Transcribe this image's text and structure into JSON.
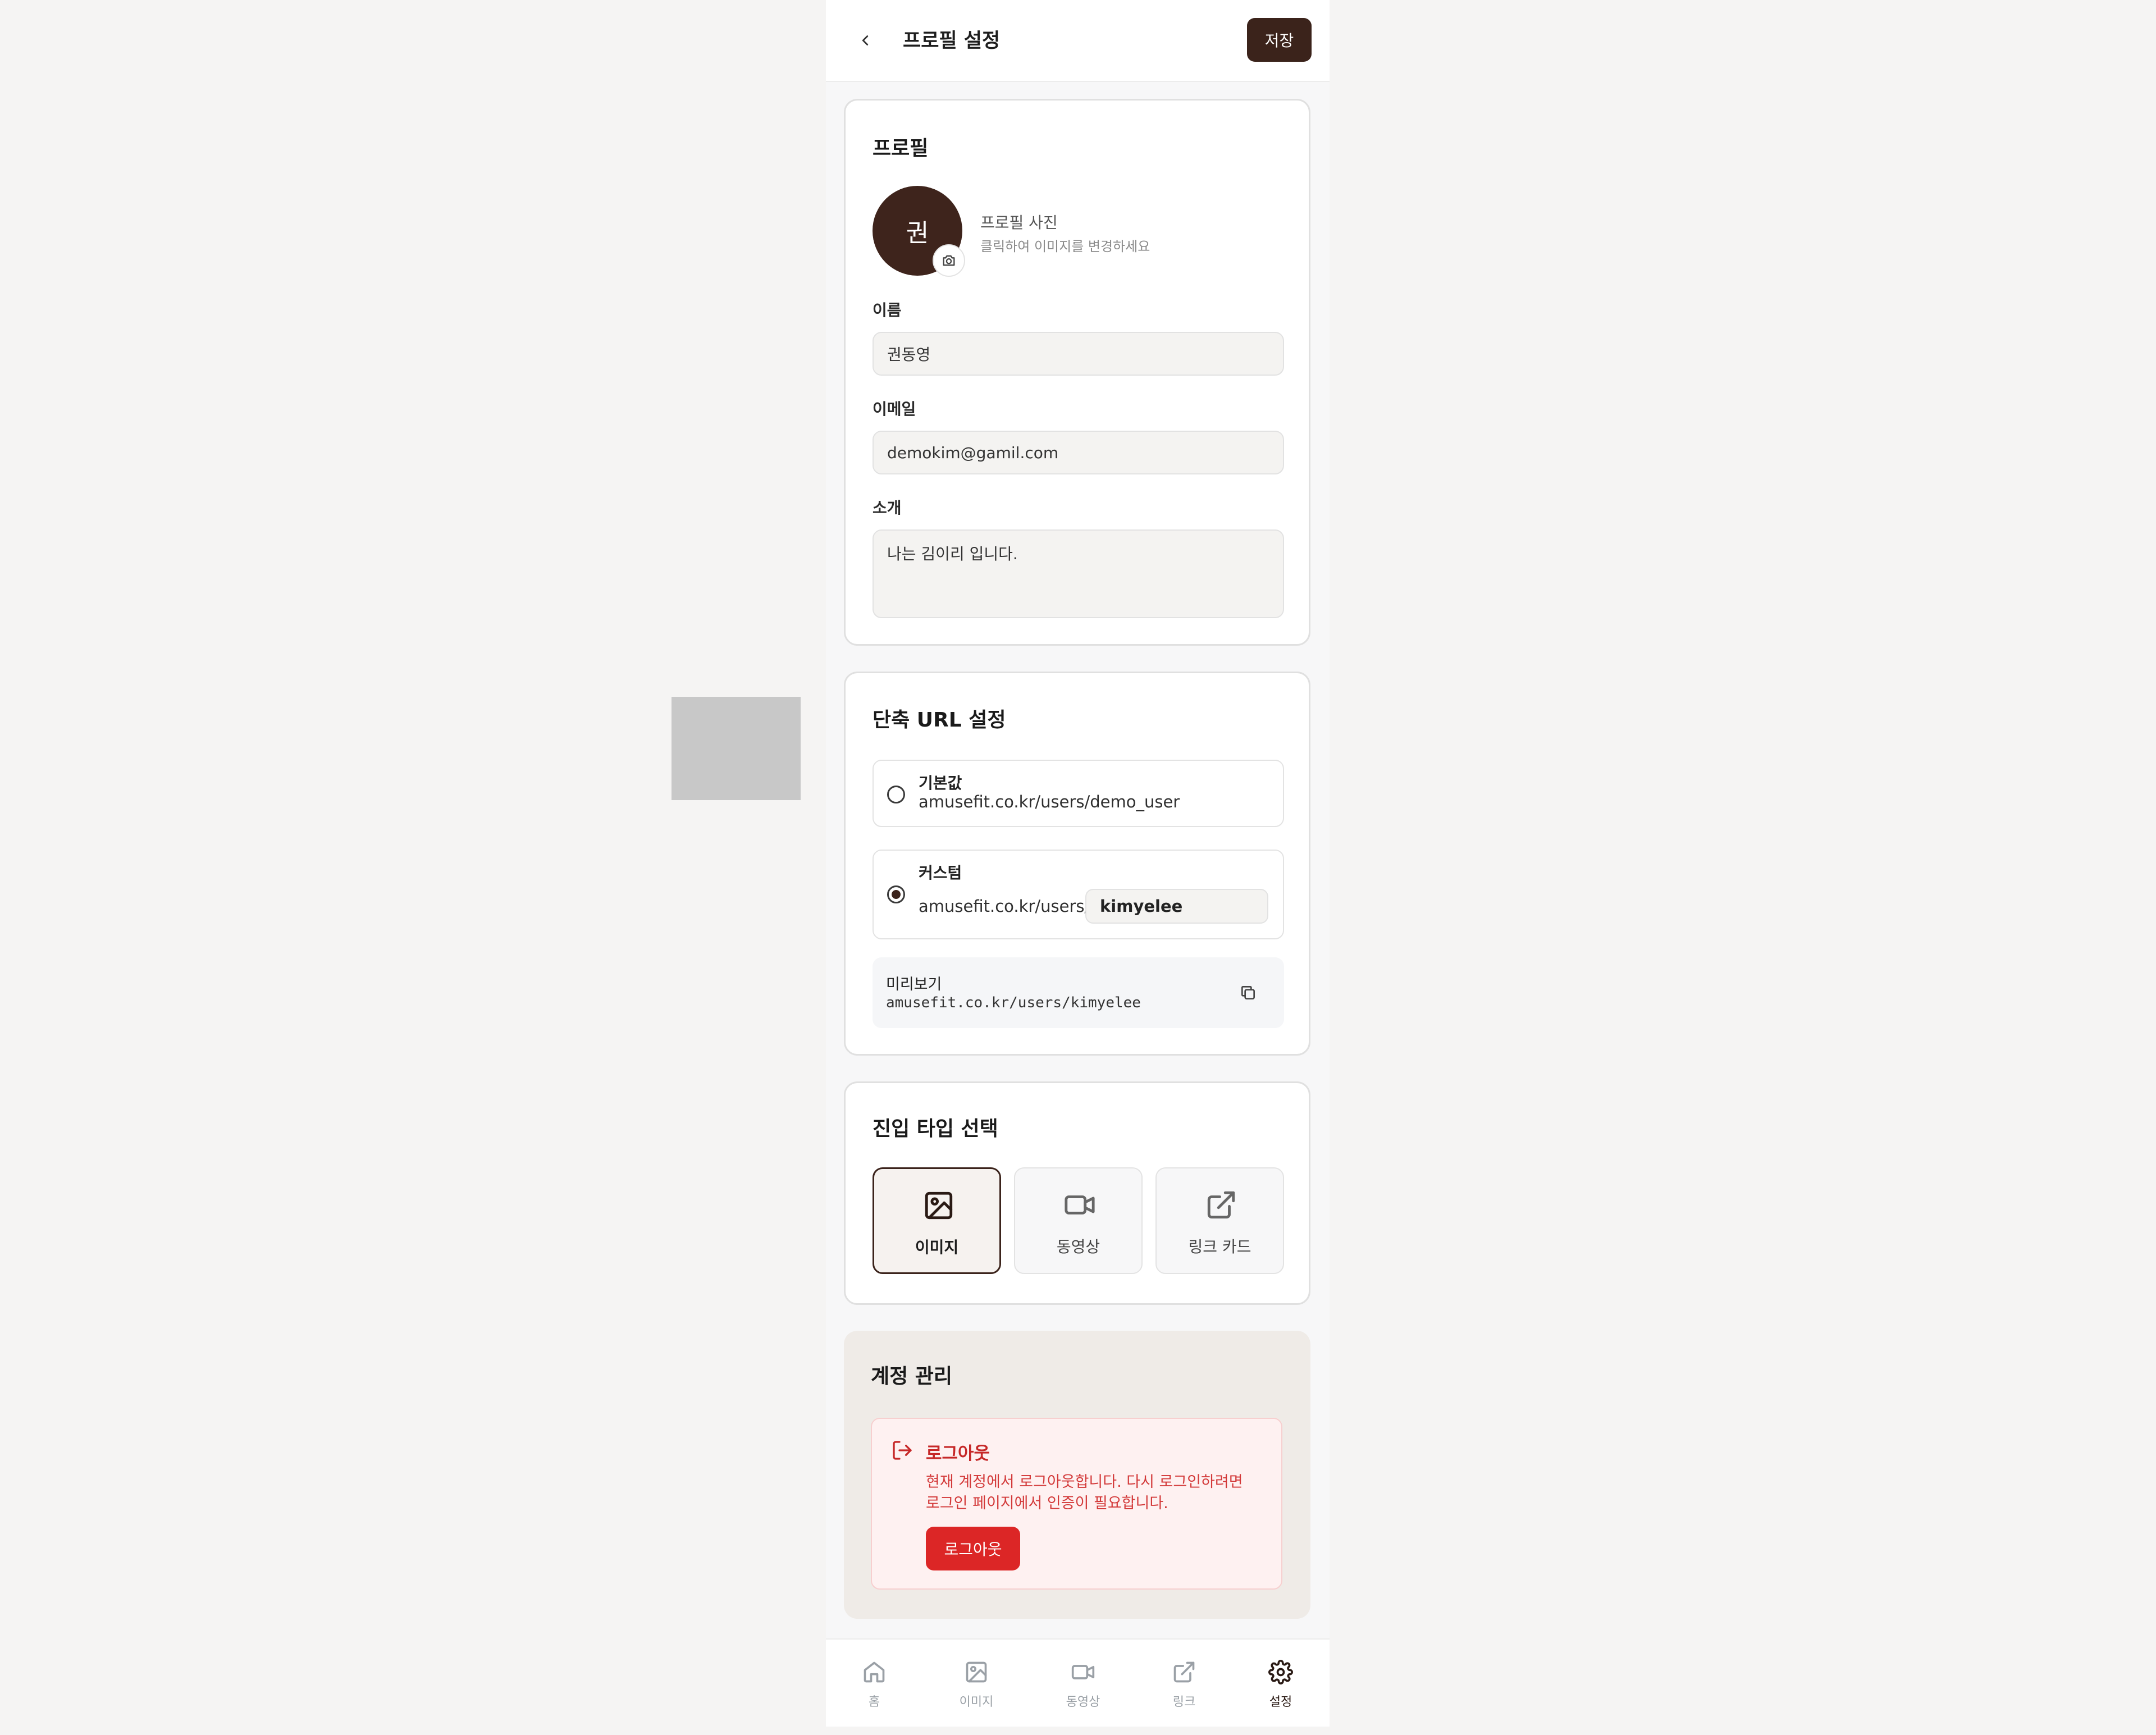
{
  "header": {
    "title": "프로필 설정",
    "save_label": "저장"
  },
  "profile": {
    "section_title": "프로필",
    "avatar_initial": "권",
    "photo_label": "프로필 사진",
    "photo_hint": "클릭하여 이미지를 변경하세요",
    "name_label": "이름",
    "name_value": "권동영",
    "email_label": "이메일",
    "email_value": "demokim@gamil.com",
    "bio_label": "소개",
    "bio_value": "나는 김이리 입니다."
  },
  "short_url": {
    "section_title": "단축 URL 설정",
    "default_option": {
      "title": "기본값",
      "url": "amusefit.co.kr/users/demo_user",
      "selected": false
    },
    "custom_option": {
      "title": "커스텀",
      "prefix": "amusefit.co.kr/users/",
      "value": "kimyelee",
      "selected": true
    },
    "preview_label": "미리보기",
    "preview_url": "amusefit.co.kr/users/kimyelee"
  },
  "entry_type": {
    "section_title": "진입 타입 선택",
    "options": [
      {
        "label": "이미지",
        "icon": "image-icon",
        "active": true
      },
      {
        "label": "동영상",
        "icon": "video-icon",
        "active": false
      },
      {
        "label": "링크 카드",
        "icon": "external-link-icon",
        "active": false
      }
    ]
  },
  "account": {
    "section_title": "계정 관리",
    "logout_title": "로그아웃",
    "logout_desc_line1": "현재 계정에서 로그아웃합니다. 다시 로그인하려면",
    "logout_desc_line2": "로그인 페이지에서 인증이 필요합니다.",
    "logout_button": "로그아웃"
  },
  "bottom_nav": {
    "items": [
      {
        "label": "홈",
        "icon": "home-icon",
        "active": false
      },
      {
        "label": "이미지",
        "icon": "image-icon",
        "active": false
      },
      {
        "label": "동영상",
        "icon": "video-icon",
        "active": false
      },
      {
        "label": "링크",
        "icon": "external-link-icon",
        "active": false
      },
      {
        "label": "설정",
        "icon": "gear-icon",
        "active": true
      }
    ]
  },
  "colors": {
    "brand": "#3b231b",
    "danger": "#dc2626",
    "danger_bg": "#fef1f1"
  }
}
